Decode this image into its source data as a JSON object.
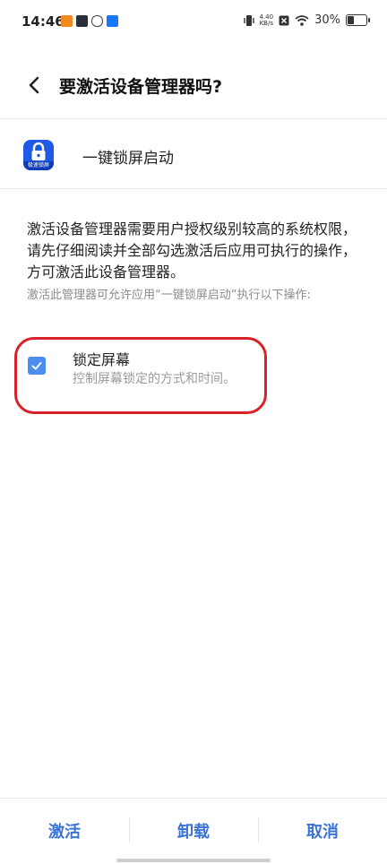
{
  "status_bar": {
    "time": "14:46",
    "net_speed": "4.40\nKB/s",
    "battery": "30%",
    "battery_level": 0.3,
    "left_icons": [
      "app-notif-orange",
      "app-notif-dark",
      "app-notif-link",
      "app-notif-blue"
    ]
  },
  "header": {
    "title": "要激活设备管理器吗?"
  },
  "app": {
    "name": "一键锁屏启动",
    "icon_text": "极速锁屏",
    "icon_color": "#1e5ae6"
  },
  "description": "激活设备管理器需要用户授权级别较高的系统权限，请先仔细阅读并全部勾选激活后应用可执行的操作，方可激活此设备管理器。",
  "sub_description": "激活此管理器可允许应用“一键锁屏启动”执行以下操作:",
  "permission": {
    "title": "锁定屏幕",
    "description": "控制屏幕锁定的方式和时间。",
    "checked": true
  },
  "buttons": {
    "activate": "激活",
    "uninstall": "卸载",
    "cancel": "取消"
  },
  "colors": {
    "accent": "#3b73d4",
    "checkbox": "#4d8df0",
    "highlight": "#d8222a"
  }
}
